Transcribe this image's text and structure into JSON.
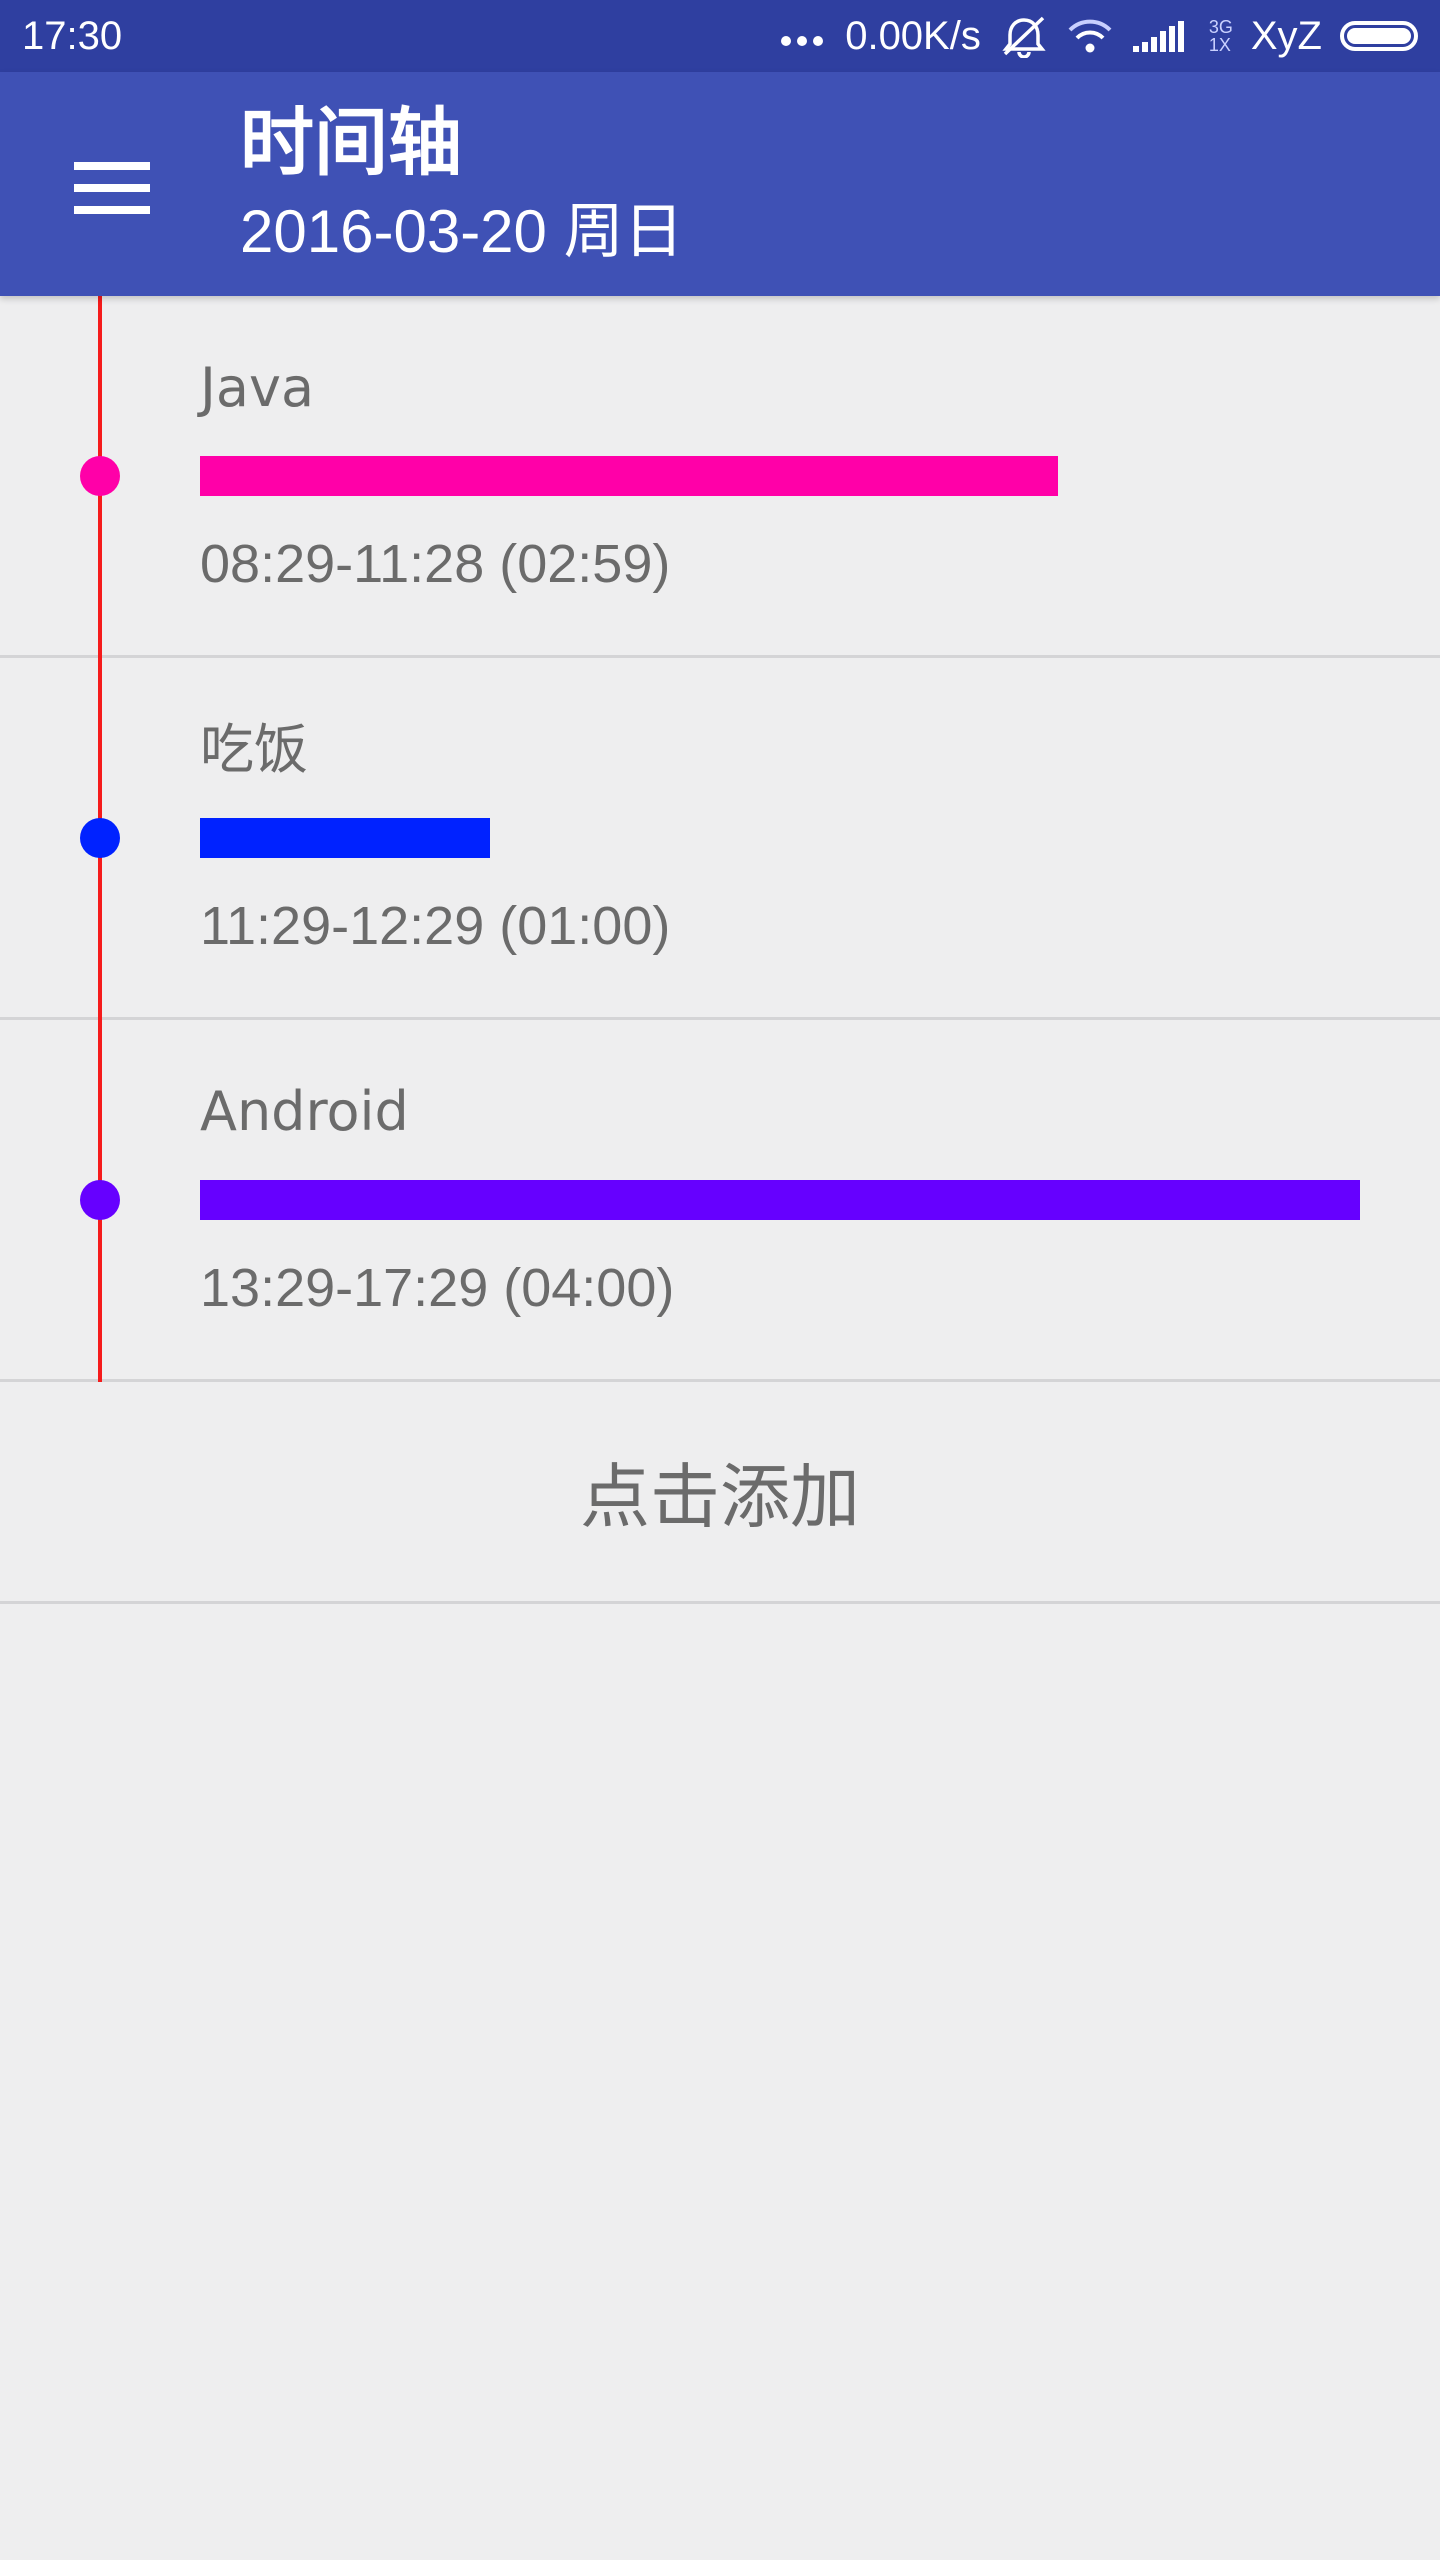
{
  "status_bar": {
    "time": "17:30",
    "net_speed": "0.00K/s",
    "net_type_top": "3G",
    "net_type_bottom": "1X",
    "carrier": "XyZ",
    "icons": [
      "more-dots-icon",
      "alarm-off-icon",
      "wifi-icon",
      "signal-icon",
      "battery-icon"
    ]
  },
  "app_bar": {
    "title": "时间轴",
    "subtitle": "2016-03-20 周日",
    "menu_icon": "hamburger-menu-icon"
  },
  "timeline": {
    "line_color": "#f51b1b",
    "items": [
      {
        "title": "Java",
        "time": "08:29-11:28 (02:59)",
        "color": "#ff00a8",
        "duration_fraction": 0.7396
      },
      {
        "title": "吃饭",
        "time": "11:29-12:29 (01:00)",
        "color": "#0022ff",
        "duration_fraction": 0.25
      },
      {
        "title": "Android",
        "time": "13:29-17:29 (04:00)",
        "color": "#6600ff",
        "duration_fraction": 1.0
      }
    ]
  },
  "add_button": {
    "label": "点击添加"
  },
  "colors": {
    "status_bar": "#2f3fa0",
    "app_bar": "#3f51b5",
    "background": "#eeeeef",
    "text": "#6b6b6b"
  }
}
